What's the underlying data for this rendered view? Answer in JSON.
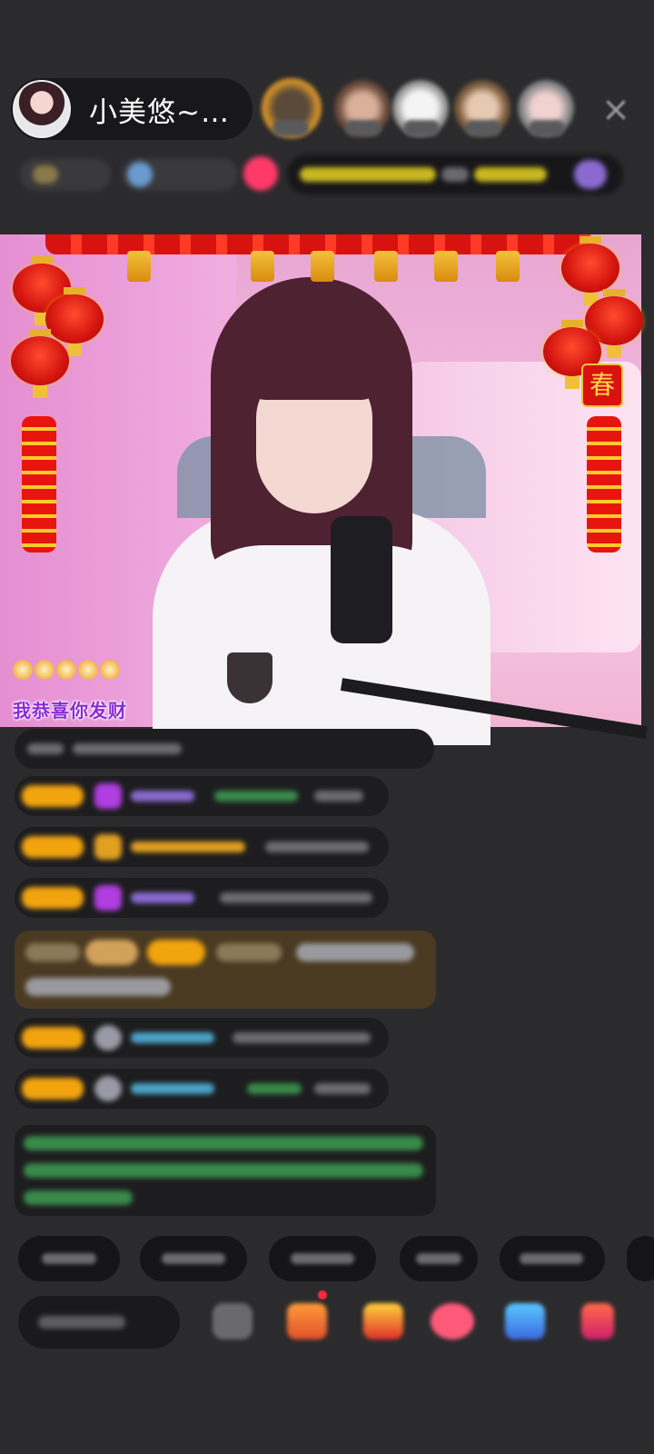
{
  "host": {
    "name": "小美悠~…"
  },
  "header": {
    "close_icon": "×"
  },
  "stream": {
    "overlay_text": "我恭喜你发财",
    "chun_char": "春"
  },
  "colors": {
    "background": "#2b2b2d",
    "level_badge": "#f2a40f",
    "gem": "#b13ee0",
    "entry_banner": "#4a3a22"
  },
  "icons": {
    "close": "close-icon",
    "emoji": "emoji-icon",
    "gift": "gift-icon",
    "red_packet": "red-packet-icon",
    "game": "game-icon"
  }
}
